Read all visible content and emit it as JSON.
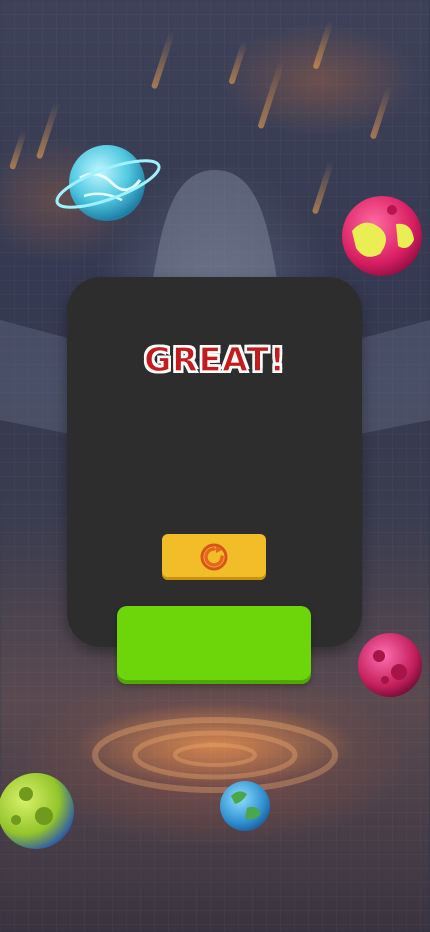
{
  "result": {
    "title": "GREAT!"
  },
  "buttons": {
    "restart_icon": "restart-icon",
    "next_icon": "none"
  },
  "colors": {
    "panel": "#2d2d2e",
    "title": "#c41c1c",
    "restart_button": "#f1be2a",
    "next_button": "#6cd60a"
  }
}
